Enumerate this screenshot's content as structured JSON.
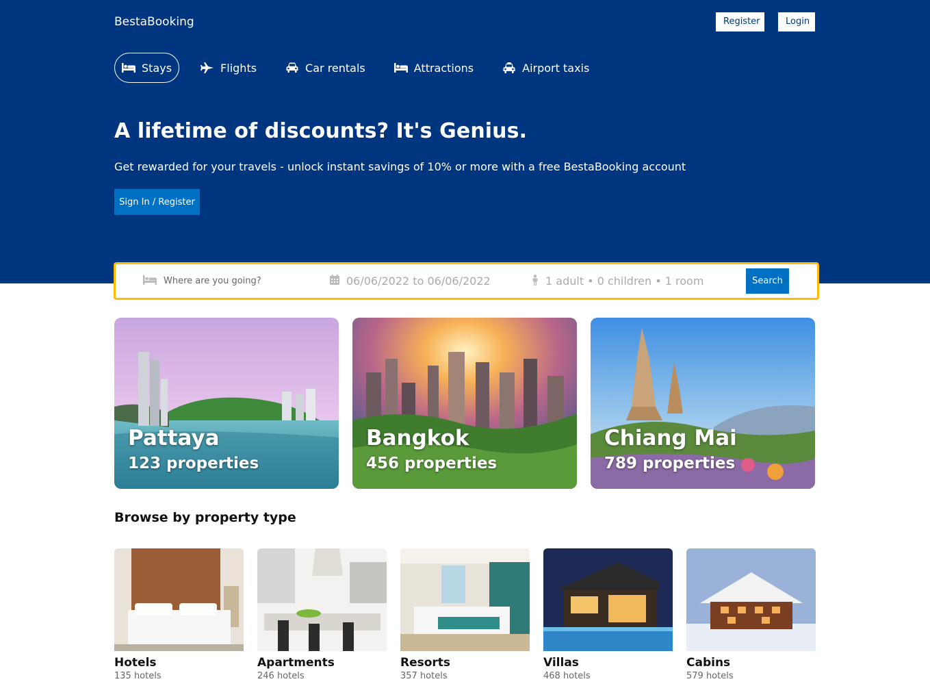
{
  "header": {
    "logo": "BestaBooking",
    "register_label": "Register",
    "login_label": "Login"
  },
  "nav": {
    "items": [
      {
        "label": "Stays",
        "icon": "bed-icon",
        "active": true
      },
      {
        "label": "Flights",
        "icon": "plane-icon",
        "active": false
      },
      {
        "label": "Car rentals",
        "icon": "car-icon",
        "active": false
      },
      {
        "label": "Attractions",
        "icon": "bed-icon",
        "active": false
      },
      {
        "label": "Airport taxis",
        "icon": "taxi-icon",
        "active": false
      }
    ]
  },
  "hero": {
    "title": "A lifetime of discounts? It's Genius.",
    "subtitle": "Get rewarded for your travels - unlock instant savings of 10% or more with a free BestaBooking account",
    "cta_label": "Sign In / Register"
  },
  "search": {
    "destination_placeholder": "Where are you going?",
    "dates": "06/06/2022 to 06/06/2022",
    "guests": "1 adult • 0 children • 1 room",
    "button_label": "Search"
  },
  "featured": [
    {
      "name": "Pattaya",
      "count": "123 properties"
    },
    {
      "name": "Bangkok",
      "count": "456 properties"
    },
    {
      "name": "Chiang Mai",
      "count": "789 properties"
    }
  ],
  "property_types": {
    "title": "Browse by property type",
    "items": [
      {
        "name": "Hotels",
        "count": "135 hotels"
      },
      {
        "name": "Apartments",
        "count": "246 hotels"
      },
      {
        "name": "Resorts",
        "count": "357 hotels"
      },
      {
        "name": "Villas",
        "count": "468 hotels"
      },
      {
        "name": "Cabins",
        "count": "579 hotels"
      }
    ]
  },
  "colors": {
    "brand_blue": "#003580",
    "button_blue": "#0071c2",
    "search_border": "#febb02"
  }
}
